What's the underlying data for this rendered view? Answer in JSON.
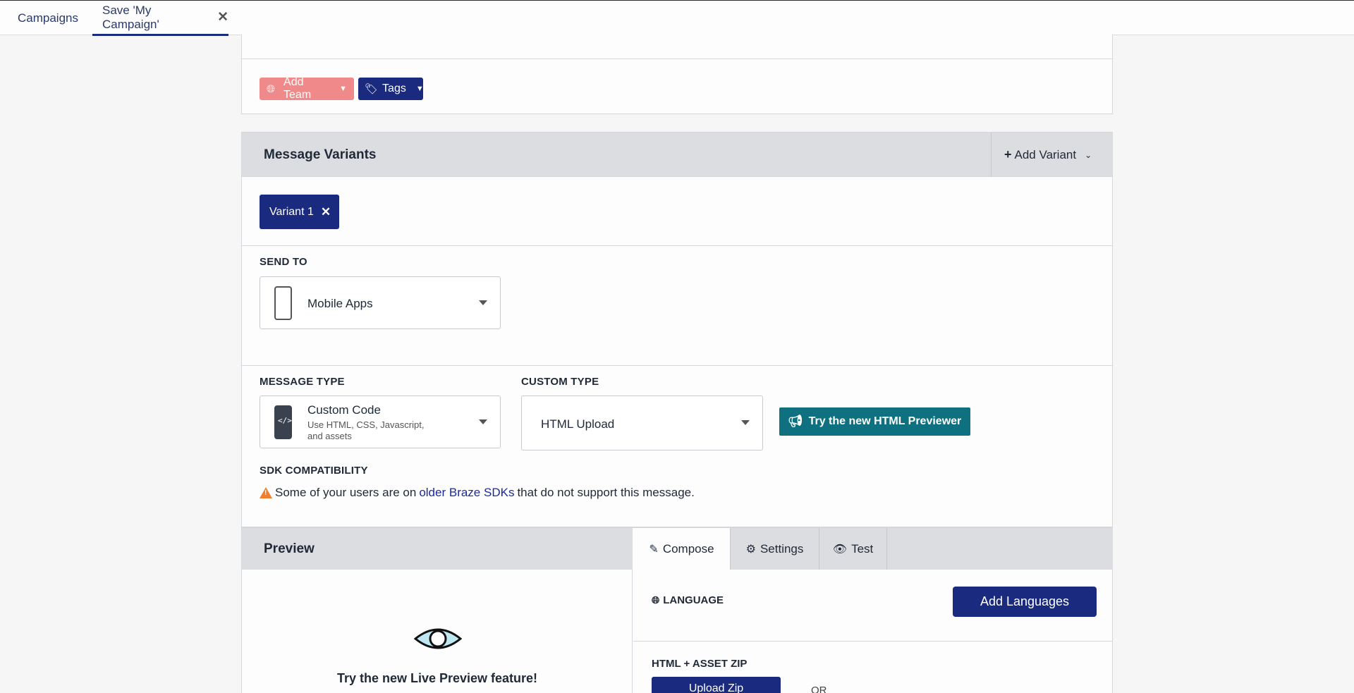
{
  "tabs": {
    "campaigns": "Campaigns",
    "save": "Save 'My Campaign'"
  },
  "top_panel": {
    "add_team": "Add Team",
    "tags": "Tags"
  },
  "message_variants": {
    "title": "Message Variants",
    "add_variant": "Add Variant",
    "variant_chip": "Variant 1"
  },
  "send_to": {
    "label": "SEND TO",
    "value": "Mobile Apps"
  },
  "message_type": {
    "label": "MESSAGE TYPE",
    "value": "Custom Code",
    "description": "Use HTML, CSS, Javascript, and assets",
    "icon_glyph": "</>"
  },
  "custom_type": {
    "label": "CUSTOM TYPE",
    "value": "HTML Upload"
  },
  "html_previewer_button": "Try the new HTML Previewer",
  "sdk": {
    "label": "SDK COMPATIBILITY",
    "text_before": "Some of your users are on",
    "link": "older Braze SDKs",
    "text_after": "that do not support this message."
  },
  "preview": {
    "title": "Preview",
    "tabs": [
      "Compose",
      "Settings",
      "Test"
    ],
    "live_preview_text": "Try the new Live Preview feature!",
    "language_label": "LANGUAGE",
    "add_languages": "Add Languages",
    "zip_label": "HTML + ASSET ZIP",
    "upload_zip": "Upload Zip",
    "or": "OR"
  },
  "colors": {
    "brand_navy": "#1a2a7e",
    "teal": "#0f7080",
    "coral": "#f08a8a",
    "warning": "#f08030"
  }
}
